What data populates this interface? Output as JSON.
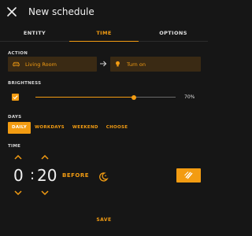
{
  "header": {
    "title": "New schedule",
    "close_icon": "close-icon"
  },
  "tabs": [
    {
      "label": "ENTITY",
      "active": false
    },
    {
      "label": "TIME",
      "active": true
    },
    {
      "label": "OPTIONS",
      "active": false
    }
  ],
  "action": {
    "section_label": "ACTION",
    "entity_label": "Living Room",
    "entity_icon": "sofa-icon",
    "arrow_icon": "arrow-right-icon",
    "service_label": "Turn on",
    "service_icon": "lightbulb-icon"
  },
  "brightness": {
    "section_label": "BRIGHTNESS",
    "enabled": true,
    "value_label": "70%",
    "value": 70
  },
  "days": {
    "section_label": "DAYS",
    "options": [
      "DAILY",
      "WORKDAYS",
      "WEEKEND",
      "CHOOSE"
    ],
    "selected": "DAILY"
  },
  "time": {
    "section_label": "TIME",
    "hours": "0",
    "separator": ":",
    "minutes": "20",
    "relation": "BEFORE",
    "event_icon": "moon-sunset-icon",
    "mode_icon": "time-mode-icon"
  },
  "footer": {
    "save_label": "SAVE"
  },
  "colors": {
    "accent": "#f39c12",
    "background": "#161616",
    "box": "#3a2a14"
  }
}
